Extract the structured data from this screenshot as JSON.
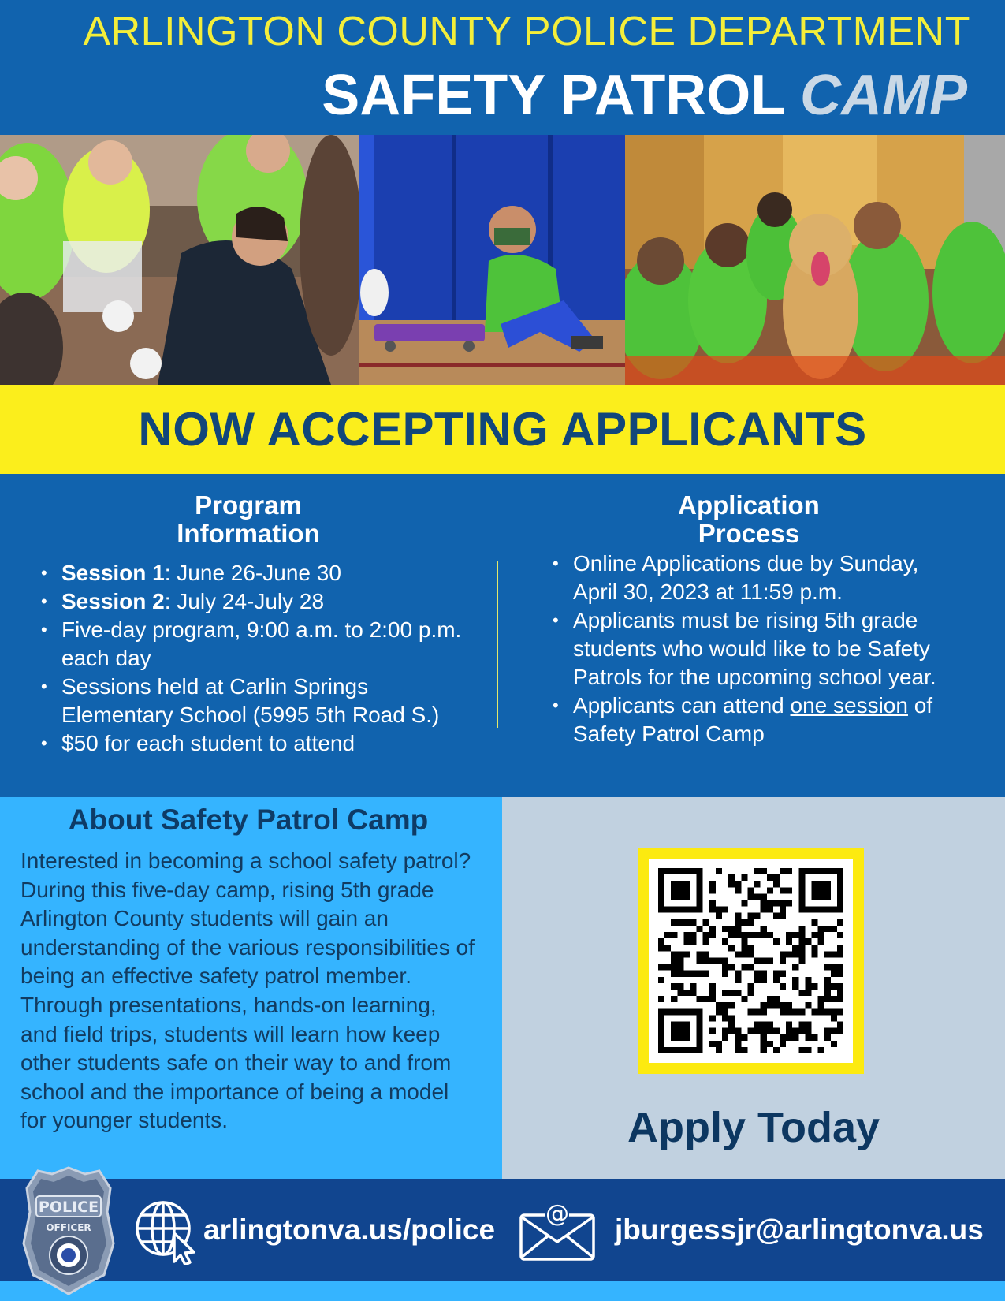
{
  "header": {
    "department": "ARLINGTON COUNTY POLICE DEPARTMENT",
    "title_main": "SAFETY PATROL",
    "title_accent": "CAMP"
  },
  "banner": {
    "text": "NOW ACCEPTING APPLICANTS"
  },
  "program": {
    "title_line1": "Program",
    "title_line2": "Information",
    "items": [
      {
        "bold": "Session 1",
        "text": ": June 26-June 30"
      },
      {
        "bold": "Session 2",
        "text": ": July 24-July 28"
      },
      {
        "text": "Five-day program, 9:00 a.m. to 2:00 p.m. each day"
      },
      {
        "text": "Sessions held at Carlin Springs Elementary School (5995 5th Road S.)"
      },
      {
        "text": "$50 for each student to attend"
      }
    ]
  },
  "application": {
    "title_line1": "Application",
    "title_line2": "Process",
    "items": [
      {
        "text": "Online Applications due by Sunday, April 30, 2023 at 11:59 p.m."
      },
      {
        "text": "Applicants must be rising 5th grade students who would like to be Safety Patrols for the upcoming school year."
      },
      {
        "before": "Applicants can attend ",
        "underline": "one session",
        "after": " of Safety Patrol Camp"
      }
    ]
  },
  "about": {
    "title": "About Safety Patrol Camp",
    "body": "Interested in becoming a school safety patrol? During this five-day camp, rising 5th grade Arlington County students will gain an understanding of the various responsibilities of being an effective safety patrol member. Through presentations, hands-on learning, and field trips, students will learn how keep other students safe on their way to and from school and the importance of being a model for younger students."
  },
  "apply": {
    "text": "Apply Today",
    "qr_icon": "qr-code"
  },
  "footer": {
    "website": "arlingtonva.us/police",
    "email": "jburgessjr@arlingtonva.us",
    "badge_text": "POLICE",
    "badge_sub": "OFFICER"
  },
  "colors": {
    "header_blue": "#1163ae",
    "yellow": "#fbee1c",
    "light_blue": "#35b4ff",
    "footer_navy": "#11458f",
    "title_navy": "#11467a"
  }
}
